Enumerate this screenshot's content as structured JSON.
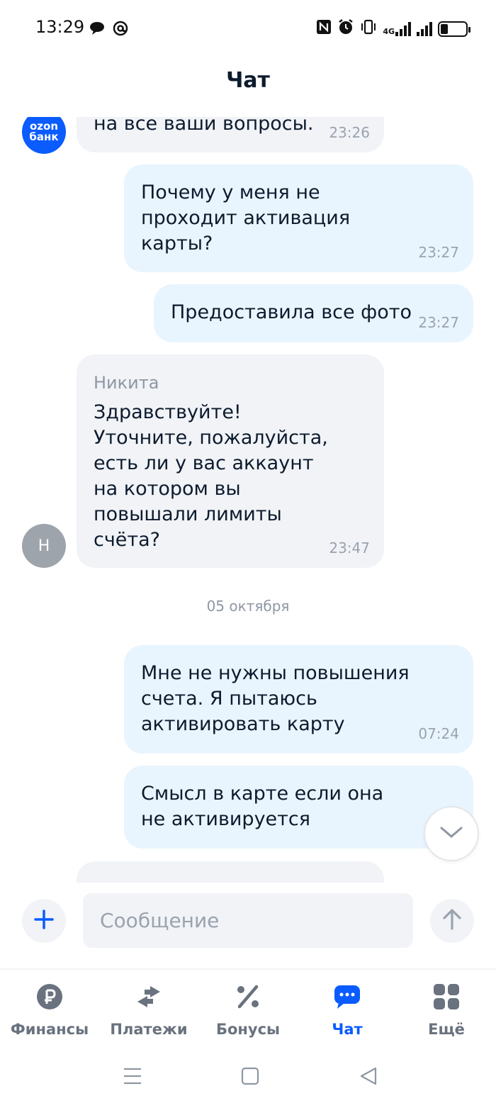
{
  "status_bar": {
    "time": "13:29",
    "left_icons": [
      "chat-bubble-icon",
      "at-sign-icon"
    ],
    "right_icons": [
      "nfc-icon",
      "alarm-icon",
      "vibrate-icon",
      "signal-4g-icon",
      "signal-icon",
      "battery-icon"
    ],
    "network_label": "4G",
    "battery_level": 0.3
  },
  "header": {
    "title": "Чат"
  },
  "messages": [
    {
      "direction": "in",
      "text": "на все ваши вопросы.",
      "time": "23:26",
      "avatar": "bank-logo"
    },
    {
      "direction": "out",
      "lines": [
        "Почему у меня не",
        "проходит активация",
        "карты?"
      ],
      "time": "23:27"
    },
    {
      "direction": "out",
      "text": "Предоставила все фото",
      "time": "23:27"
    },
    {
      "direction": "in",
      "sender": "Никита",
      "lines": [
        "Здравствуйте!",
        "Уточните, пожалуйста,",
        "есть ли у вас аккаунт",
        "на котором вы",
        "повышали лимиты",
        "счёта?"
      ],
      "time": "23:47",
      "avatar_letter": "Н"
    },
    {
      "direction": "out",
      "lines": [
        "Мне не нужны повышения",
        "счета. Я пытаюсь",
        "активировать карту"
      ],
      "time": "07:24"
    },
    {
      "direction": "out",
      "lines": [
        "Смысл в карте если она",
        "не активируется"
      ],
      "time": ""
    }
  ],
  "avatars": {
    "bank_line1": "ozon",
    "bank_line2": "банк",
    "agent_letter": "Н"
  },
  "date_separator": "05 октября",
  "composer": {
    "placeholder": "Сообщение"
  },
  "bottom_nav": {
    "items": [
      {
        "label": "Финансы",
        "icon": "ruble-coin-icon"
      },
      {
        "label": "Платежи",
        "icon": "transfer-arrows-icon"
      },
      {
        "label": "Бонусы",
        "icon": "percent-icon"
      },
      {
        "label": "Чат",
        "icon": "chat-dots-icon",
        "active": true
      },
      {
        "label": "Ещё",
        "icon": "grid-icon"
      }
    ]
  },
  "colors": {
    "accent": "#0a5cff",
    "incoming_bubble": "#f1f3f7",
    "outgoing_bubble": "#e9f5fe",
    "muted_text": "#9aa3ae",
    "text": "#0d1b2e"
  }
}
